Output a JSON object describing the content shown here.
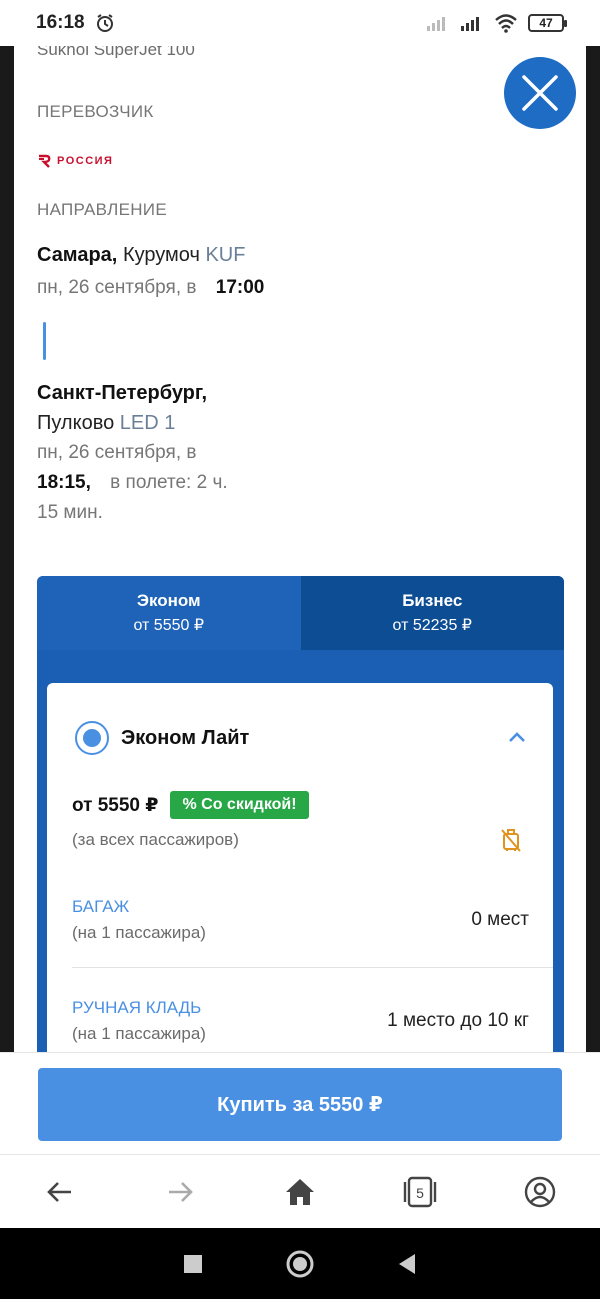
{
  "status_bar": {
    "time": "16:18",
    "battery": "47"
  },
  "flight": {
    "aircraft": "Sukhoi SuperJet 100",
    "carrier_label": "ПЕРЕВОЗЧИК",
    "carrier_name": "РОССИЯ",
    "direction_label": "НАПРАВЛЕНИЕ",
    "departure": {
      "city": "Самара,",
      "airport": "Курумоч",
      "iata": "KUF",
      "date": "пн, 26 сентября, в",
      "time": "17:00"
    },
    "arrival": {
      "city": "Санкт-Петербург,",
      "airport": "Пулково",
      "iata": "LED 1",
      "date": "пн, 26 сентября, в",
      "time": "18:15,",
      "duration_a": "в полете: 2 ч.",
      "duration_b": "15 мин."
    }
  },
  "fare_tabs": [
    {
      "name": "Эконом",
      "price": "от 5550 ₽"
    },
    {
      "name": "Бизнес",
      "price": "от 52235 ₽"
    }
  ],
  "fare_card": {
    "name": "Эконом Лайт",
    "price": "от 5550 ₽",
    "badge": "% Со скидкой!",
    "price_note": "(за всех пассажиров)",
    "baggage": {
      "label": "БАГАЖ",
      "sub": "(на 1 пассажира)",
      "value": "0 мест"
    },
    "hand_luggage": {
      "label": "РУЧНАЯ КЛАДЬ",
      "sub": "(на 1 пассажира)",
      "value": "1 место до 10 кг"
    }
  },
  "buy_button": "Купить за 5550 ₽",
  "browser": {
    "tabs_count": "5"
  },
  "colors": {
    "accent": "#4a90e2",
    "tab_active": "#1f63b8",
    "tab_inactive": "#0d4d94",
    "badge": "#27a745",
    "brand_red": "#c8102e"
  }
}
